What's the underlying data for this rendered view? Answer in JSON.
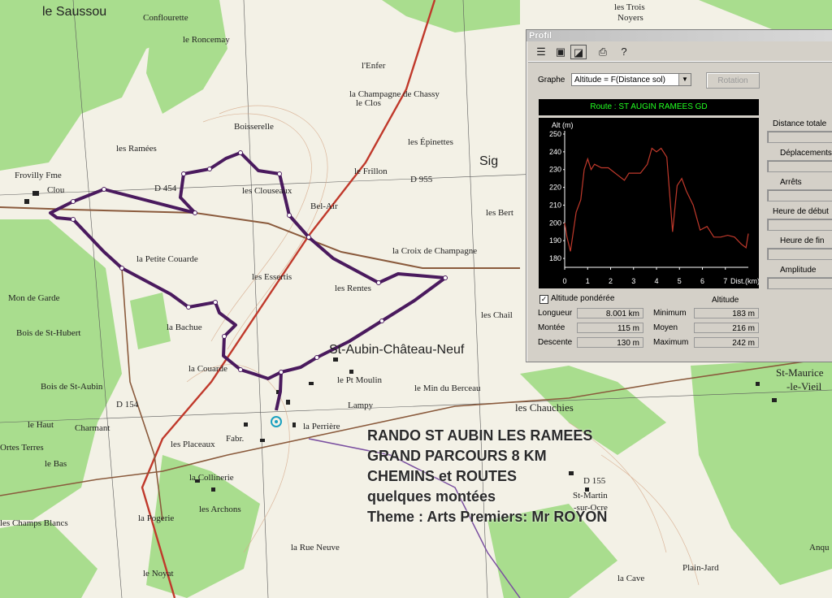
{
  "map": {
    "place_labels": [
      {
        "text": "le Saussou"
      },
      {
        "text": "le Roncemay"
      },
      {
        "text": "Conflourette"
      },
      {
        "text": "les Trois"
      },
      {
        "text": "Noyers"
      },
      {
        "text": "l'Enfer"
      },
      {
        "text": "le Clos"
      },
      {
        "text": "la Champagne de Chassy"
      },
      {
        "text": "Boisserelle"
      },
      {
        "text": "les Ramées"
      },
      {
        "text": "les Épinettes"
      },
      {
        "text": "le Frillon"
      },
      {
        "text": "les Clouseaux"
      },
      {
        "text": "Frovilly Fme"
      },
      {
        "text": "Clou"
      },
      {
        "text": "D 454"
      },
      {
        "text": "Bel-Air"
      },
      {
        "text": "les Bert"
      },
      {
        "text": "la Croix de Champagne"
      },
      {
        "text": "la Petite Couarde"
      },
      {
        "text": "les Essertis"
      },
      {
        "text": "les Rentes"
      },
      {
        "text": "Mon de Garde"
      },
      {
        "text": "Bois de St-Hubert"
      },
      {
        "text": "les Chail"
      },
      {
        "text": "la Bachue"
      },
      {
        "text": "St-Aubin-Château-Neuf"
      },
      {
        "text": "Bois de St-Aubin"
      },
      {
        "text": "la Couarde"
      },
      {
        "text": "le Pt Moulin"
      },
      {
        "text": "Lampy"
      },
      {
        "text": "le Min du Berceau"
      },
      {
        "text": "les Chauchies"
      },
      {
        "text": "St-Maurice"
      },
      {
        "text": "-le-Vieil"
      },
      {
        "text": "le Haut"
      },
      {
        "text": "Charmant"
      },
      {
        "text": "la Perrière"
      },
      {
        "text": "les Placeaux"
      },
      {
        "text": "Fabr."
      },
      {
        "text": "la Collinerie"
      },
      {
        "text": "Ortes Terres"
      },
      {
        "text": "le Bas"
      },
      {
        "text": "les Archons"
      },
      {
        "text": "D 155"
      },
      {
        "text": "St-Martin"
      },
      {
        "text": "-sur-Ocre"
      },
      {
        "text": "les Champs Blancs"
      },
      {
        "text": "la Pogerie"
      },
      {
        "text": "le Noyat"
      },
      {
        "text": "la Rue Neuve"
      },
      {
        "text": "Plain-Jard"
      },
      {
        "text": "la Cave"
      },
      {
        "text": "Anqu"
      },
      {
        "text": "D 154"
      },
      {
        "text": "D 955"
      },
      {
        "text": "Sig"
      }
    ],
    "overlay_lines": [
      "RANDO ST AUBIN LES RAMEES",
      "GRAND PARCOURS 8 KM",
      "CHEMINS et ROUTES",
      "quelques montées",
      "Theme : Arts Premiers: Mr ROYON"
    ]
  },
  "profile_window": {
    "title": "Profil",
    "toolbar_icons": [
      "list-icon",
      "properties-icon",
      "profile-view-icon",
      "print-icon",
      "help-icon"
    ],
    "graphe_label": "Graphe",
    "graphe_value": "Altitude = F(Distance sol)",
    "rotation_button": "Rotation",
    "route_title": "Route : ST AUGIN RAMEES GD",
    "right_fields": [
      "Distance totale",
      "Déplacements",
      "Arrêts",
      "Heure de début",
      "Heure de fin",
      "Amplitude"
    ],
    "altitude_ponderee": "Altitude pondérée",
    "altitude_ponderee_checked": true,
    "altitude_header": "Altitude",
    "stats_left": [
      {
        "label": "Longueur",
        "value": "8.001 km"
      },
      {
        "label": "Montée",
        "value": "115 m"
      },
      {
        "label": "Descente",
        "value": "130 m"
      }
    ],
    "stats_right": [
      {
        "label": "Minimum",
        "value": "183 m"
      },
      {
        "label": "Moyen",
        "value": "216 m"
      },
      {
        "label": "Maximum",
        "value": "242 m"
      }
    ],
    "colors": {
      "chart_bg": "#000000",
      "chart_line": "#c0392b",
      "axis": "#ffffff",
      "title_text": "#22ee22"
    }
  },
  "chart_data": {
    "type": "line",
    "title": "Route : ST AUGIN RAMEES GD",
    "xlabel": "Dist.(km)",
    "ylabel": "Alt (m)",
    "xlim": [
      0,
      8
    ],
    "ylim": [
      175,
      250
    ],
    "xticks": [
      0,
      1,
      2,
      3,
      4,
      5,
      6,
      7
    ],
    "yticks": [
      180,
      190,
      200,
      210,
      220,
      230,
      240,
      250
    ],
    "grid": false,
    "series": [
      {
        "x": [
          0,
          0.1,
          0.25,
          0.5,
          0.7,
          0.85,
          1.0,
          1.15,
          1.3,
          1.6,
          1.9,
          2.1,
          2.3,
          2.6,
          2.8,
          3.0,
          3.3,
          3.6,
          3.8,
          4.0,
          4.2,
          4.45,
          4.7,
          4.9,
          5.1,
          5.3,
          5.6,
          5.9,
          6.2,
          6.5,
          6.8,
          7.1,
          7.4,
          7.7,
          7.9,
          8.0
        ],
        "y": [
          200,
          192,
          184,
          206,
          213,
          230,
          236,
          230,
          233,
          231,
          231,
          229,
          227,
          224,
          228,
          228,
          228,
          233,
          242,
          240,
          242,
          237,
          195,
          221,
          225,
          218,
          210,
          196,
          198,
          192,
          192,
          193,
          192,
          188,
          186,
          194
        ]
      }
    ]
  }
}
